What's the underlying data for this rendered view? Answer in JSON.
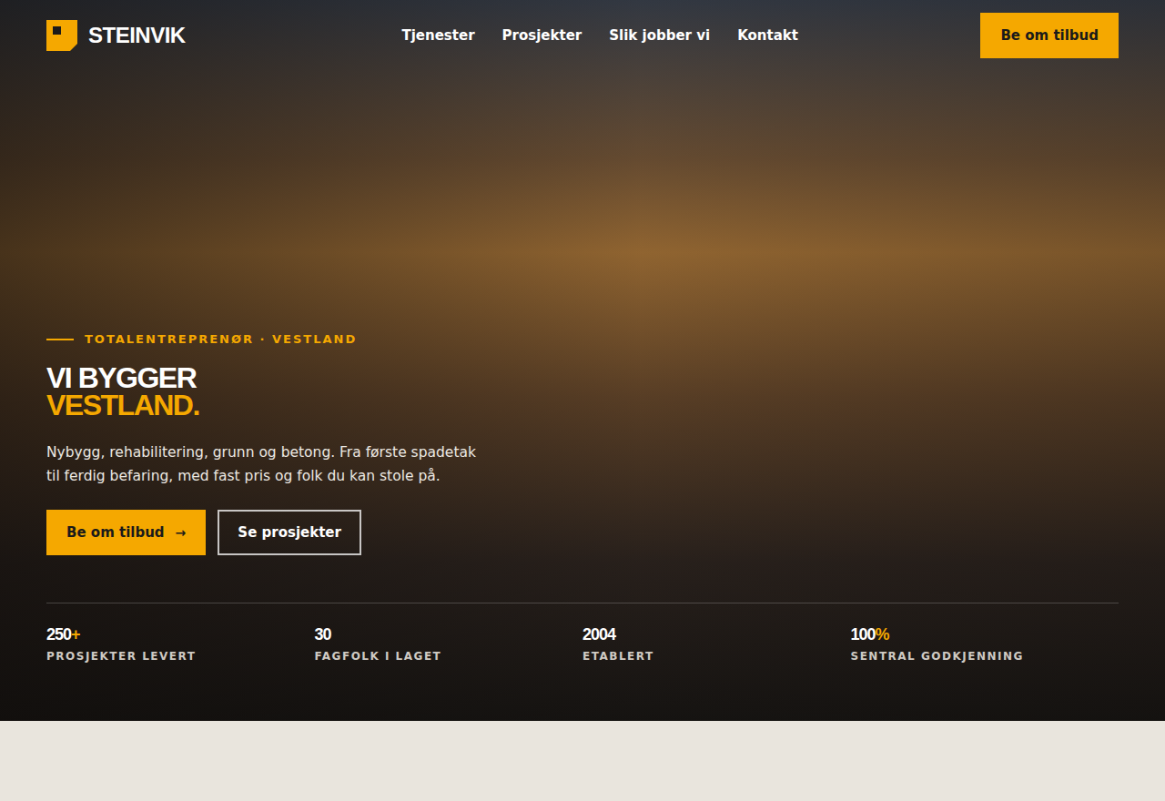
{
  "brand": {
    "name": "STEINVIK"
  },
  "nav": {
    "items": [
      {
        "label": "Tjenester"
      },
      {
        "label": "Prosjekter"
      },
      {
        "label": "Slik jobber vi"
      },
      {
        "label": "Kontakt"
      }
    ],
    "cta": "Be om tilbud"
  },
  "hero": {
    "eyebrow": "TOTALENTREPRENØR · VESTLAND",
    "title_lines": [
      {
        "text": "VI BYGGER",
        "accent": false
      },
      {
        "text": "VESTLAND.",
        "accent": true
      }
    ],
    "lead": "Nybygg, rehabilitering, grunn og betong. Fra første spadetak til ferdig befaring, med fast pris og folk du kan stole på.",
    "buttons": [
      {
        "label": "Be om tilbud",
        "icon": "→",
        "kind": "primary"
      },
      {
        "label": "Se prosjekter",
        "icon": "",
        "kind": "outline"
      }
    ]
  },
  "stats": [
    {
      "value": "250",
      "suffix": "+",
      "label": "PROSJEKTER LEVERT"
    },
    {
      "value": "30",
      "suffix": "",
      "label": "FAGFOLK I LAGET"
    },
    {
      "value": "2004",
      "suffix": "",
      "label": "ETABLERT"
    },
    {
      "value": "100",
      "suffix": "%",
      "label": "SENTRAL GODKJENNING"
    }
  ]
}
